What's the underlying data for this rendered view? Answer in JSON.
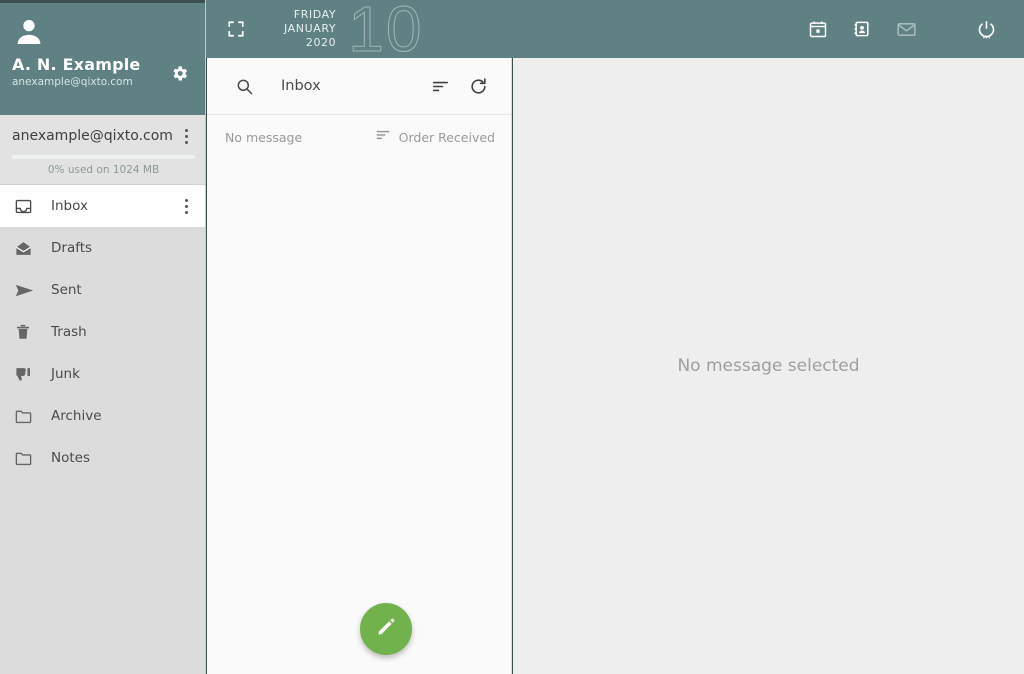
{
  "theme": {
    "accent_teal": "#5f8183",
    "compose_green": "#72b24c",
    "sidebar_bg": "#dcdcdc",
    "list_bg": "#fafafa",
    "reading_bg": "#eeeeee"
  },
  "topbar": {
    "fullscreen_icon": "fullscreen-icon",
    "date": {
      "weekday": "FRIDAY",
      "month": "JANUARY",
      "year": "2020",
      "day": "10"
    },
    "actions": [
      {
        "name": "calendar",
        "icon": "calendar-icon",
        "active": false
      },
      {
        "name": "contacts",
        "icon": "contacts-icon",
        "active": false
      },
      {
        "name": "mail",
        "icon": "mail-icon",
        "active": true
      },
      {
        "name": "power",
        "icon": "power-icon",
        "active": false
      }
    ]
  },
  "sidebar": {
    "avatar_icon": "person-icon",
    "display_name": "A. N. Example",
    "email": "anexample@qixto.com",
    "settings_icon": "gear-icon",
    "account": {
      "address": "anexample@qixto.com",
      "menu_icon": "kebab-menu-icon",
      "quota_percent": 0,
      "quota_text": "0% used on 1024 MB"
    },
    "folders": [
      {
        "label": "Inbox",
        "icon": "inbox-icon",
        "active": true,
        "has_menu": true
      },
      {
        "label": "Drafts",
        "icon": "drafts-icon",
        "active": false,
        "has_menu": false
      },
      {
        "label": "Sent",
        "icon": "sent-icon",
        "active": false,
        "has_menu": false
      },
      {
        "label": "Trash",
        "icon": "trash-icon",
        "active": false,
        "has_menu": false
      },
      {
        "label": "Junk",
        "icon": "junk-icon",
        "active": false,
        "has_menu": false
      },
      {
        "label": "Archive",
        "icon": "archive-icon",
        "active": false,
        "has_menu": false
      },
      {
        "label": "Notes",
        "icon": "notes-icon",
        "active": false,
        "has_menu": false
      }
    ]
  },
  "message_list": {
    "search_icon": "search-icon",
    "title": "Inbox",
    "sort_icon": "sort-icon",
    "refresh_icon": "refresh-icon",
    "status_text": "No message",
    "order_icon": "sort-icon",
    "order_label": "Order Received",
    "compose_icon": "pencil-icon",
    "messages": []
  },
  "reading_pane": {
    "empty_text": "No message selected"
  }
}
